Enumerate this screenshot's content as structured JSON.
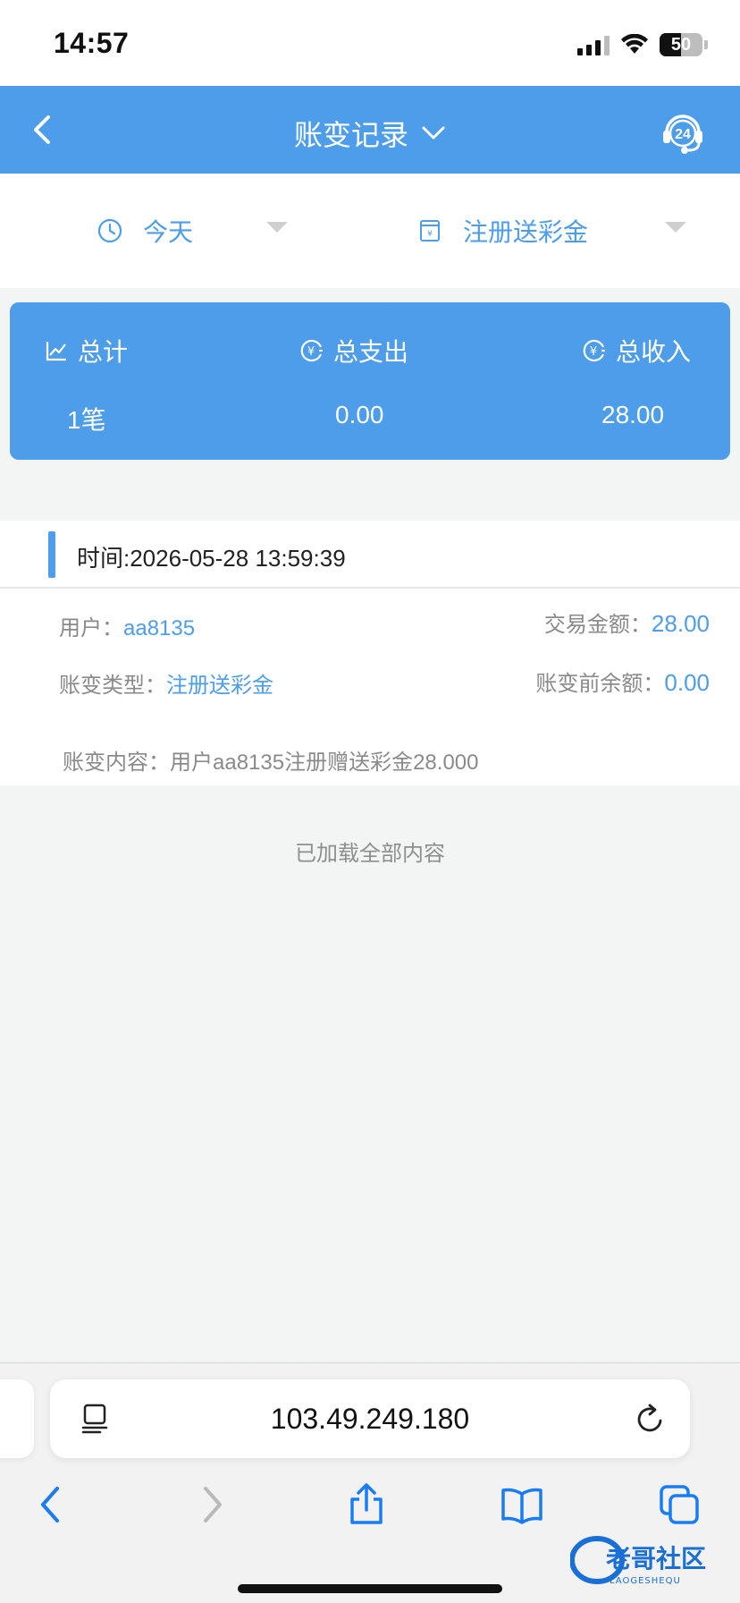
{
  "status_bar": {
    "time": "14:57",
    "battery": "50"
  },
  "nav": {
    "title": "账变记录",
    "support_badge": "24"
  },
  "filters": {
    "date": "今天",
    "type": "注册送彩金"
  },
  "summary": {
    "total_label": "总计",
    "total_value": "1笔",
    "expense_label": "总支出",
    "expense_value": "0.00",
    "income_label": "总收入",
    "income_value": "28.00"
  },
  "record": {
    "time": "时间:2026-05-28 13:59:39",
    "user_label": "用户：",
    "user_value": "aa8135",
    "amount_label": "交易金额：",
    "amount_value": "28.00",
    "type_label": "账变类型：",
    "type_value": "注册送彩金",
    "before_label": "账变前余额：",
    "before_value": "0.00",
    "content": "账变内容：用户aa8135注册赠送彩金28.000"
  },
  "loaded_text": "已加载全部内容",
  "browser": {
    "address": "103.49.249.180"
  },
  "watermark": {
    "text": "老哥社区",
    "sub": "LAOGESHEQU"
  },
  "colors": {
    "accent": "#4d9deb",
    "bg": "#f3f4f4"
  }
}
